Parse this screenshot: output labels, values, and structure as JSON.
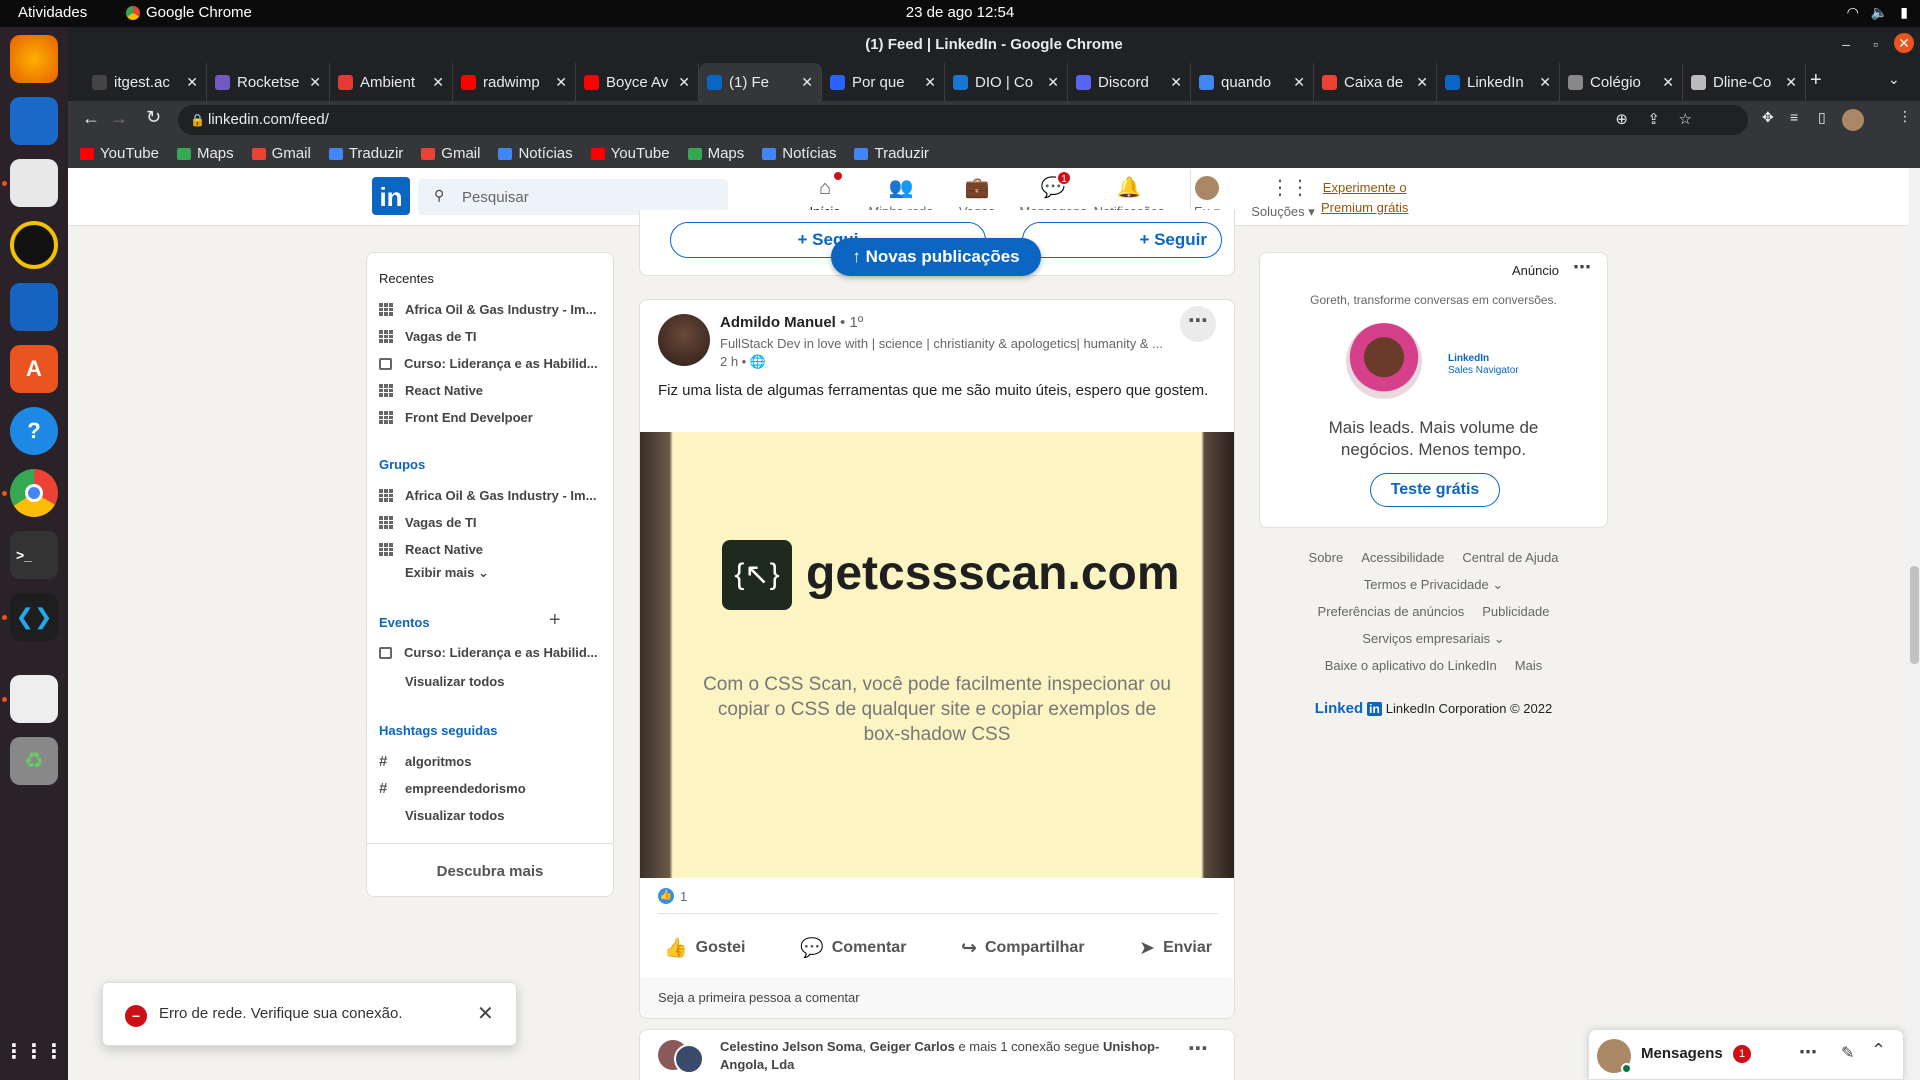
{
  "os": {
    "activities": "Atividades",
    "app_name": "Google Chrome",
    "clock": "23 de ago  12:54"
  },
  "chrome": {
    "window_title": "(1) Feed | LinkedIn - Google Chrome",
    "tabs": [
      {
        "title": "itgest.ac",
        "color": "#444444"
      },
      {
        "title": "Rocketse",
        "color": "#7159c1"
      },
      {
        "title": "Ambient",
        "color": "#e53935"
      },
      {
        "title": "radwimp",
        "color": "#ff0000"
      },
      {
        "title": "Boyce Av",
        "color": "#ff0000"
      },
      {
        "title": "(1) Fe",
        "color": "#0a66c2",
        "active": true
      },
      {
        "title": "Por que",
        "color": "#2962ff"
      },
      {
        "title": "DIO | Co",
        "color": "#1976d2"
      },
      {
        "title": "Discord",
        "color": "#5865f2"
      },
      {
        "title": "quando",
        "color": "#4285f4"
      },
      {
        "title": "Caixa de",
        "color": "#ea4335"
      },
      {
        "title": "LinkedIn",
        "color": "#0a66c2"
      },
      {
        "title": "Colégio",
        "color": "#888888"
      },
      {
        "title": "Dline-Co",
        "color": "#bbbbbb"
      }
    ],
    "url": "linkedin.com/feed/",
    "bookmarks": [
      {
        "label": "YouTube",
        "color": "#ff0000"
      },
      {
        "label": "Maps",
        "color": "#34a853"
      },
      {
        "label": "Gmail",
        "color": "#ea4335"
      },
      {
        "label": "Traduzir",
        "color": "#4285f4"
      },
      {
        "label": "Gmail",
        "color": "#ea4335"
      },
      {
        "label": "Notícias",
        "color": "#4285f4"
      },
      {
        "label": "YouTube",
        "color": "#ff0000"
      },
      {
        "label": "Maps",
        "color": "#34a853"
      },
      {
        "label": "Notícias",
        "color": "#4285f4"
      },
      {
        "label": "Traduzir",
        "color": "#4285f4"
      }
    ]
  },
  "linkedin": {
    "logo": "in",
    "search_placeholder": "Pesquisar",
    "nav": [
      {
        "label": "Início",
        "badge": ""
      },
      {
        "label": "Minha rede",
        "badge": ""
      },
      {
        "label": "Vagas",
        "badge": ""
      },
      {
        "label": "Mensagens",
        "badge": "1"
      },
      {
        "label": "Notificações",
        "badge": ""
      },
      {
        "label": "Eu",
        "badge": ""
      },
      {
        "label": "Soluções",
        "badge": ""
      }
    ],
    "premium": {
      "line1": "Experimente o",
      "line2": "Premium grátis"
    },
    "left": {
      "recent_title": "Recentes",
      "recent": [
        {
          "label": "Africa Oil & Gas Industry - Im...",
          "icon": "group"
        },
        {
          "label": "Vagas de TI",
          "icon": "group"
        },
        {
          "label": "Curso: Liderança e as Habilid...",
          "icon": "calendar"
        },
        {
          "label": "React Native",
          "icon": "group"
        },
        {
          "label": "Front End Develpoer",
          "icon": "group"
        }
      ],
      "groups_title": "Grupos",
      "groups": [
        "Africa Oil & Gas Industry - Im...",
        "Vagas de TI",
        "React Native"
      ],
      "show_more": "Exibir mais",
      "events_title": "Eventos",
      "events": [
        "Curso: Liderança e as Habilid..."
      ],
      "events_view_all": "Visualizar todos",
      "hashtags_title": "Hashtags seguidas",
      "hashtags": [
        "algoritmos",
        "empreendedorismo"
      ],
      "hashtags_view_all": "Visualizar todos",
      "discover": "Descubra mais"
    },
    "feed": {
      "follow_left": "+ Segui",
      "follow_right": "+ Seguir",
      "new_posts": "Novas publicações",
      "post": {
        "author": "Admildo Manuel",
        "degree": "• 1º",
        "headline": "FullStack Dev in love with | science | christianity & apologetics| humanity & ...",
        "time": "2 h •",
        "text": "Fiz uma lista de algumas ferramentas que me são muito úteis, espero que gostem.",
        "image_title": "getcssscan.com",
        "image_text": "Com o CSS Scan, você pode facilmente inspecionar ou copiar o CSS de qualquer site e copiar exemplos de box-shadow CSS",
        "reactions": "1",
        "actions": [
          "Gostei",
          "Comentar",
          "Compartilhar",
          "Enviar"
        ],
        "first_comment": "Seja a primeira pessoa a comentar"
      },
      "next_post": {
        "name1": "Celestino Jelson Soma",
        "sep": ", ",
        "name2": "Geiger Carlos",
        "mid": " e mais 1 conexão segue ",
        "org": "Unishop-Angola, Lda"
      }
    },
    "ad": {
      "label": "Anúncio",
      "tagline": "Goreth, transforme conversas em conversões.",
      "brand": "LinkedIn",
      "brand_sub": "Sales Navigator",
      "headline": "Mais leads. Mais volume de negócios. Menos tempo.",
      "cta": "Teste grátis"
    },
    "footer": {
      "links_row1": [
        "Sobre",
        "Acessibilidade",
        "Central de Ajuda"
      ],
      "links_row2": [
        "Termos e Privacidade"
      ],
      "links_row3": [
        "Preferências de anúncios",
        "Publicidade"
      ],
      "links_row4": [
        "Serviços empresariais"
      ],
      "links_row5": [
        "Baixe o aplicativo do LinkedIn",
        "Mais"
      ],
      "brand": "Linked",
      "copyright": "LinkedIn Corporation © 2022"
    },
    "toast": {
      "message": "Erro de rede. Verifique sua conexão."
    },
    "messaging": {
      "label": "Mensagens",
      "count": "1"
    }
  }
}
